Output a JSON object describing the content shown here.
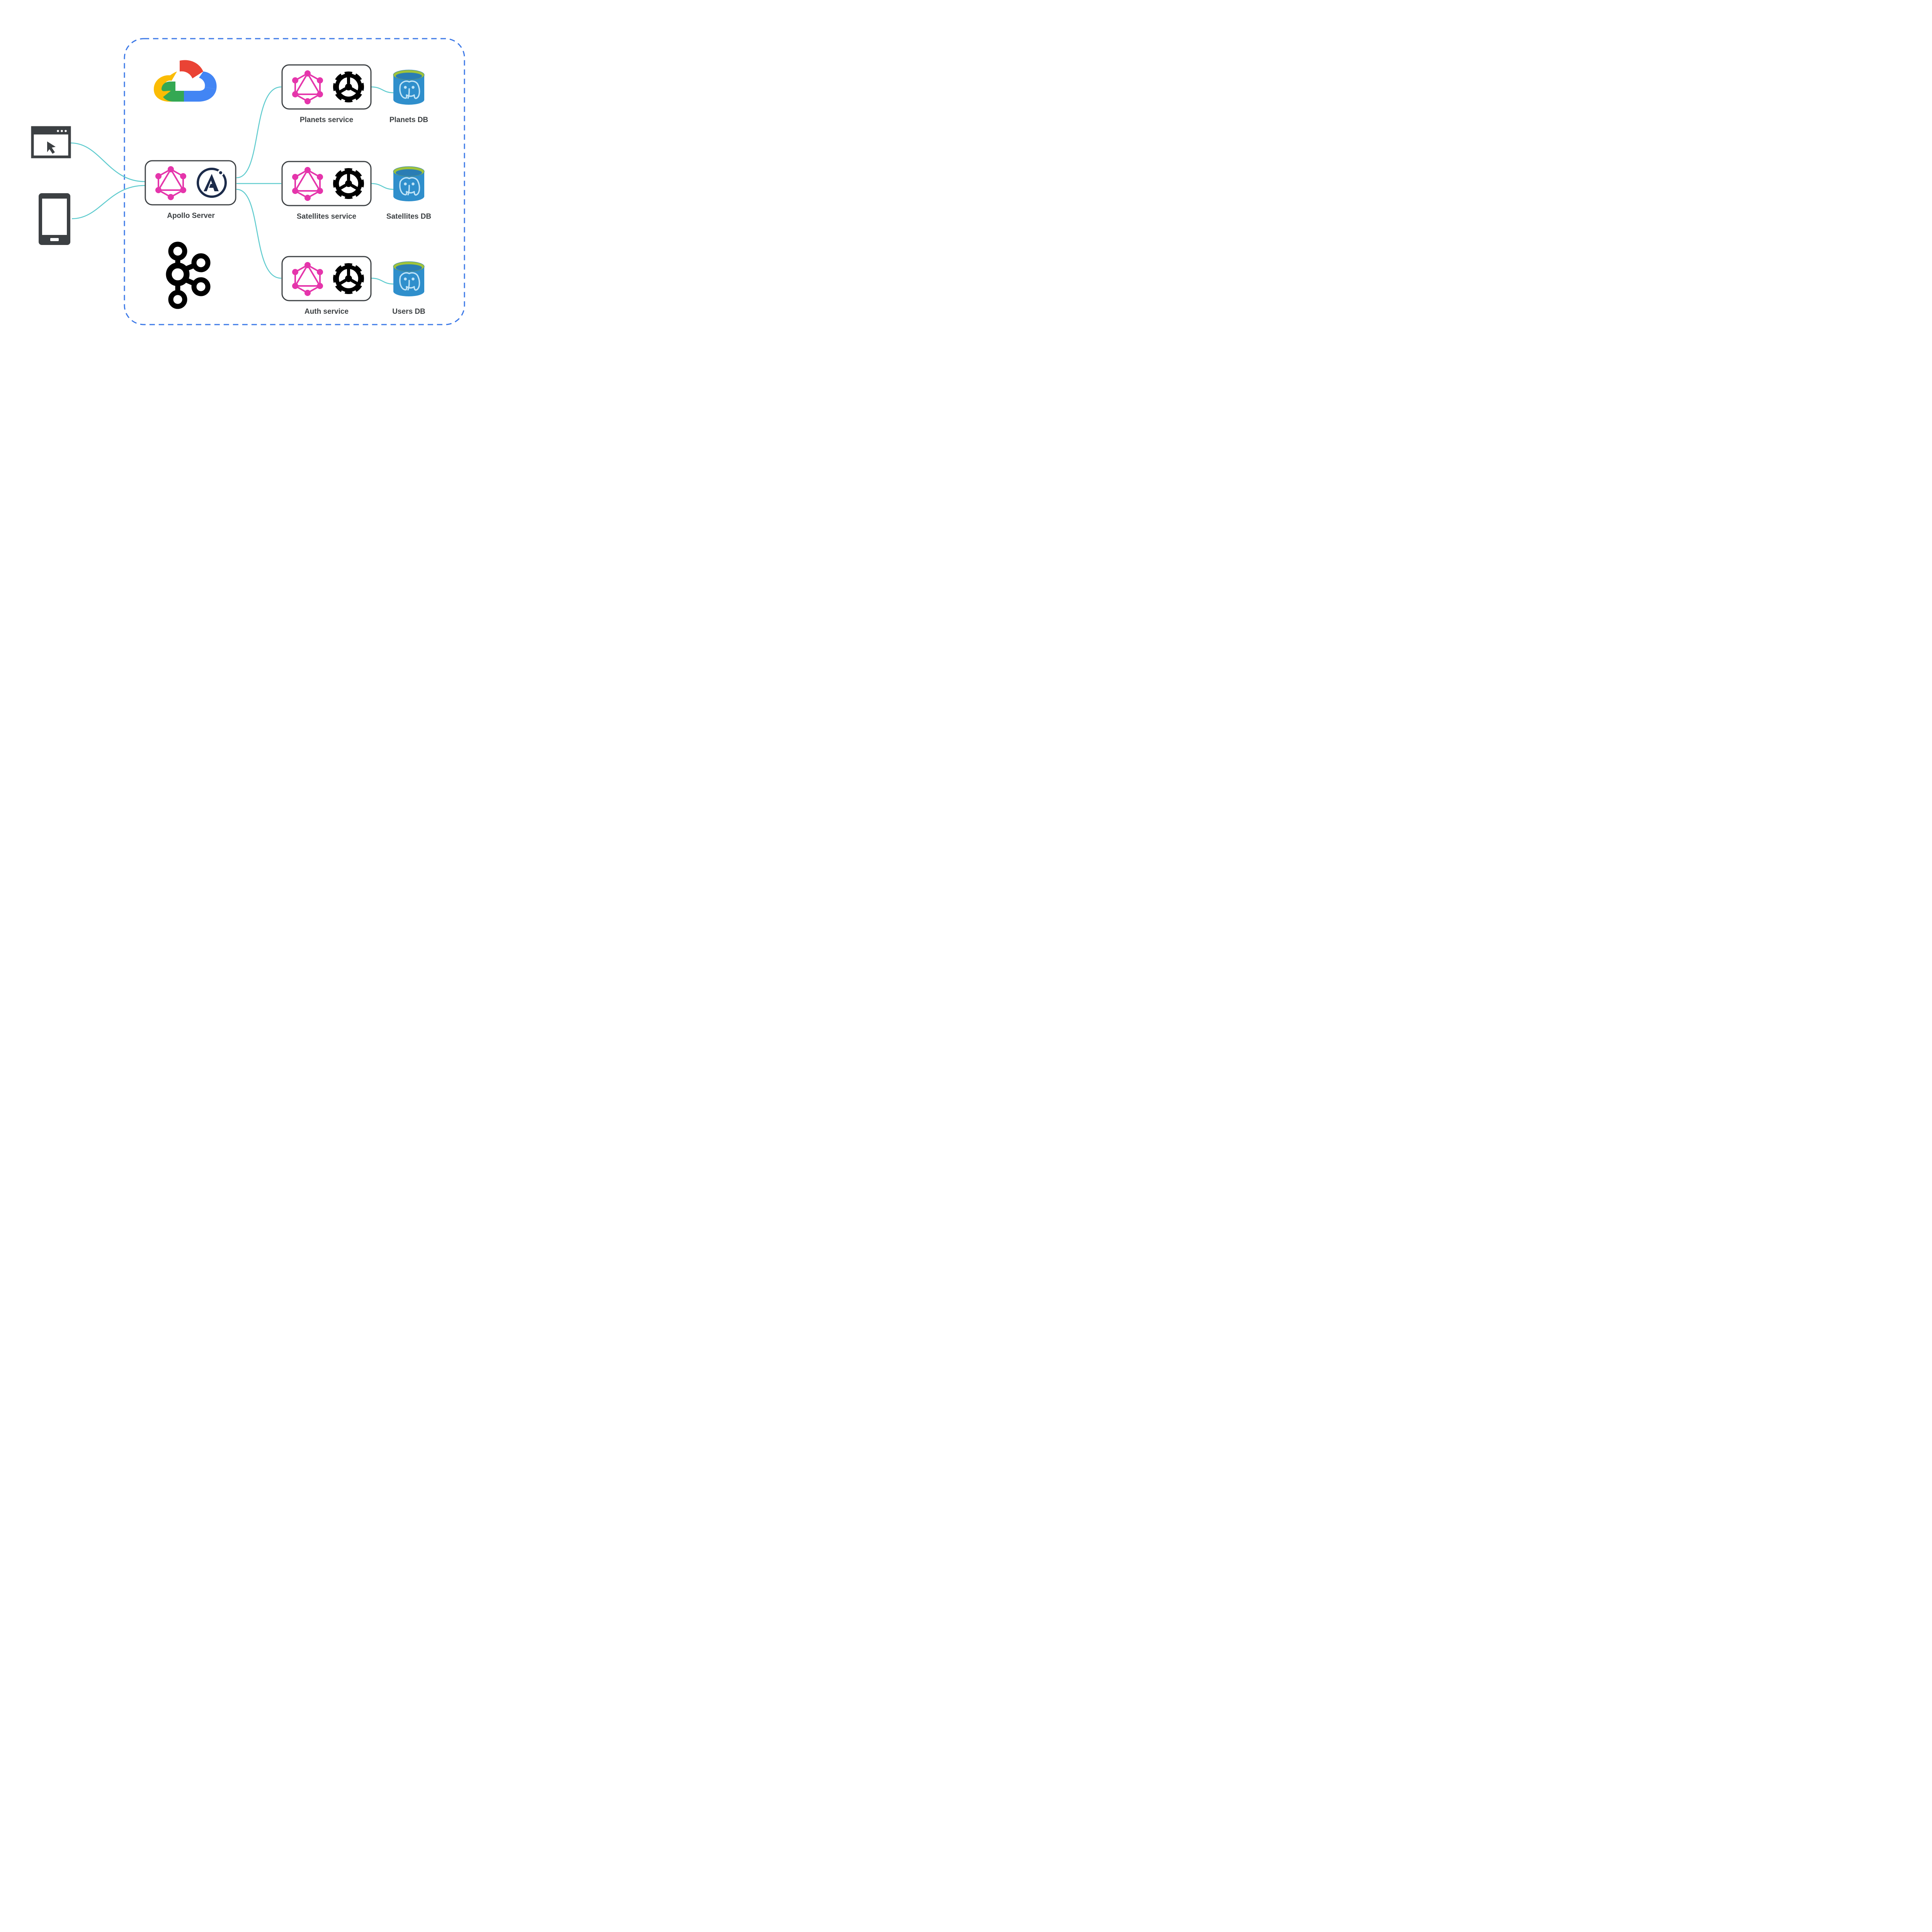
{
  "diagram": {
    "boundary": "cloud-region",
    "clients": [
      "browser-client",
      "mobile-client"
    ],
    "gateway": {
      "label": "Apollo Server",
      "tech": [
        "graphql",
        "apollo"
      ]
    },
    "infra_icons": [
      "google-cloud",
      "apache-kafka"
    ],
    "services": [
      {
        "label": "Planets service",
        "db_label": "Planets DB"
      },
      {
        "label": "Satellites service",
        "db_label": "Satellites DB"
      },
      {
        "label": "Auth service",
        "db_label": "Users DB"
      }
    ],
    "service_tech": [
      "graphql",
      "rust-gear"
    ],
    "db_tech": "postgresql",
    "connector_color": "#5ecbce"
  }
}
